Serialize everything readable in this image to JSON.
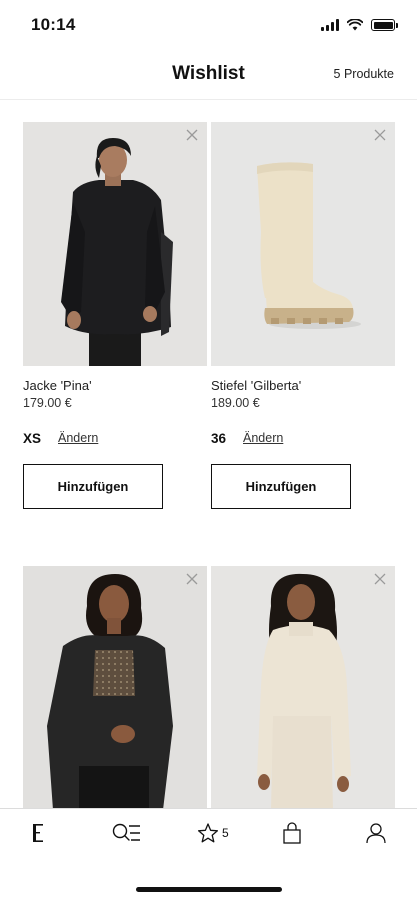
{
  "status_bar": {
    "time": "10:14"
  },
  "header": {
    "title": "Wishlist",
    "count": "5 Produkte"
  },
  "products": [
    {
      "name": "Jacke 'Pina'",
      "price": "179.00 €",
      "size": "XS",
      "change_label": "Ändern",
      "add_label": "Hinzufügen"
    },
    {
      "name": "Stiefel 'Gilberta'",
      "price": "189.00 €",
      "size": "36",
      "change_label": "Ändern",
      "add_label": "Hinzufügen"
    },
    {
      "name": "",
      "price": ""
    },
    {
      "name": "",
      "price": ""
    }
  ],
  "tabbar": {
    "items": [
      {
        "name": "home",
        "icon": "edited-logo-icon"
      },
      {
        "name": "search",
        "icon": "search-menu-icon"
      },
      {
        "name": "wishlist",
        "icon": "star-icon",
        "badge": "5"
      },
      {
        "name": "bag",
        "icon": "shopping-bag-icon"
      },
      {
        "name": "account",
        "icon": "user-icon"
      }
    ]
  },
  "colors": {
    "accent": "#111111",
    "image_bg": "#e4e3e1",
    "divider": "#ececec"
  }
}
